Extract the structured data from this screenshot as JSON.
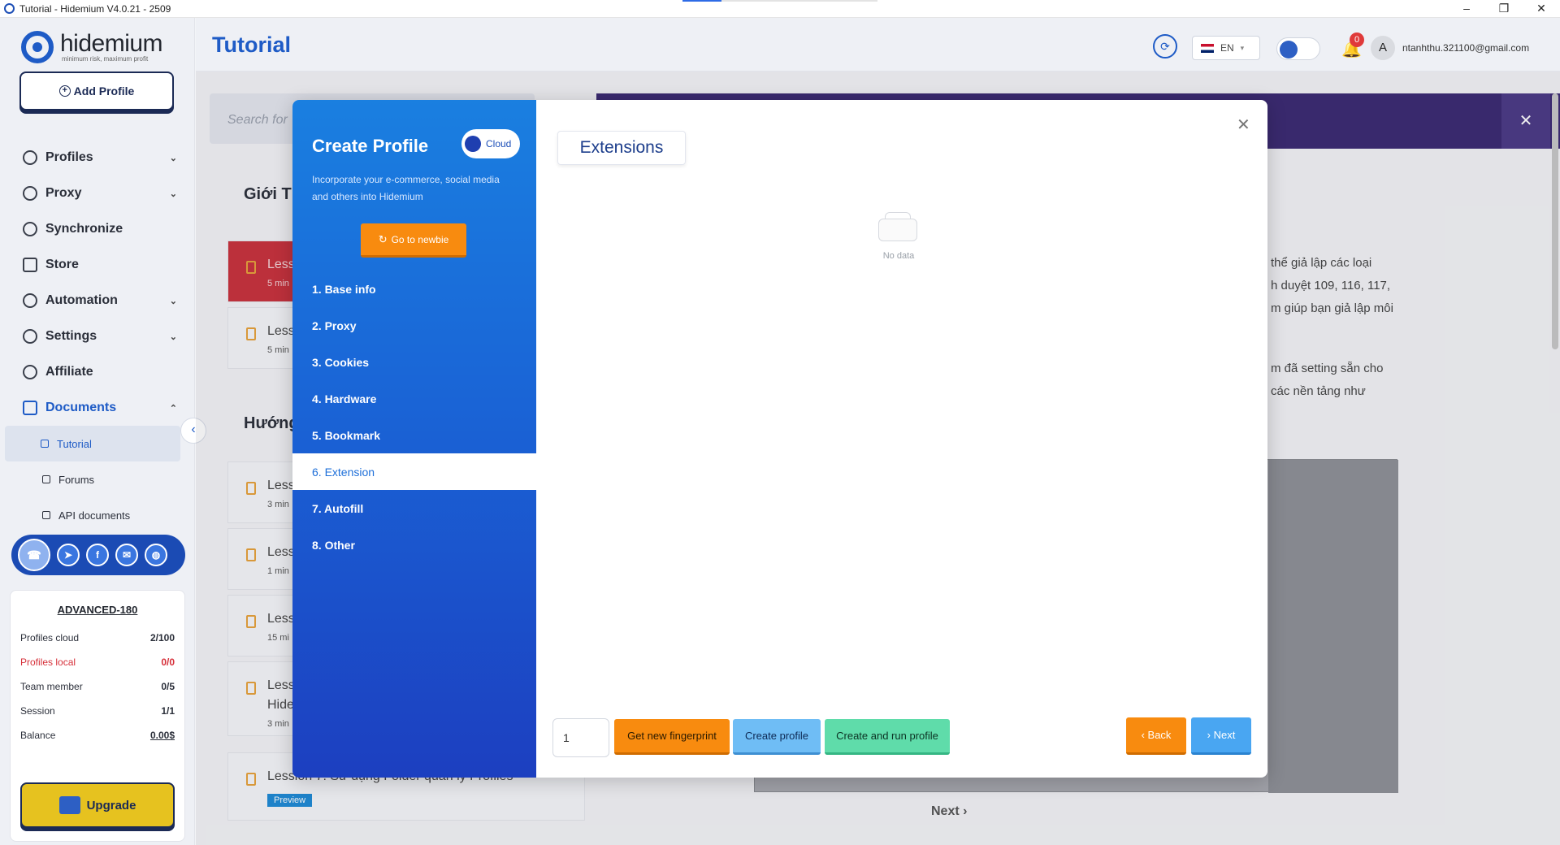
{
  "window": {
    "title": "Tutorial - Hidemium V4.0.21 - 2509",
    "minimize": "–",
    "maximize": "❐",
    "close": "✕"
  },
  "sidebar": {
    "logo_name": "hidemium",
    "logo_tagline": "minimum risk, maximum profit",
    "add_profile": "Add Profile",
    "items": [
      {
        "label": "Profiles",
        "icon": "profiles-icon",
        "chevron": "⌄"
      },
      {
        "label": "Proxy",
        "icon": "globe-icon",
        "chevron": "⌄"
      },
      {
        "label": "Synchronize",
        "icon": "sync-gear-icon"
      },
      {
        "label": "Store",
        "icon": "store-icon"
      },
      {
        "label": "Automation",
        "icon": "automation-icon",
        "chevron": "⌄"
      },
      {
        "label": "Settings",
        "icon": "gear-icon",
        "chevron": "⌄"
      },
      {
        "label": "Affiliate",
        "icon": "affiliate-icon"
      },
      {
        "label": "Documents",
        "icon": "documents-icon",
        "chevron": "⌃"
      }
    ],
    "sub_items": [
      {
        "label": "Tutorial"
      },
      {
        "label": "Forums"
      },
      {
        "label": "API documents"
      }
    ],
    "plan": {
      "title": "ADVANCED-180",
      "rows": [
        {
          "label": "Profiles cloud",
          "value": "2/100"
        },
        {
          "label": "Profiles local",
          "value": "0/0"
        },
        {
          "label": "Team member",
          "value": "0/5"
        },
        {
          "label": "Session",
          "value": "1/1"
        },
        {
          "label": "Balance",
          "value": "0.00$"
        }
      ],
      "upgrade": "Upgrade"
    }
  },
  "header": {
    "title": "Tutorial",
    "lang": "EN",
    "notification_count": "0",
    "avatar_letter": "A",
    "email": "ntanhthu.321100@gmail.com"
  },
  "background": {
    "search_placeholder": "Search for",
    "section1": "Giới T",
    "section2": "Hướng",
    "lessons": [
      {
        "title": "Less",
        "meta": "5 min"
      },
      {
        "title": "Less",
        "meta": "5 min"
      },
      {
        "title": "Less",
        "meta": "3 min"
      },
      {
        "title": "Less",
        "meta": "1 min"
      },
      {
        "title": "Less",
        "meta": "15 mi"
      },
      {
        "title": "Less",
        "meta": "3 min",
        "extra": "Hide"
      },
      {
        "title": "Lession 7: Sử dụng Folder quản lý Profiles",
        "badge": "Preview"
      }
    ],
    "text_lines": [
      "thể giả lập các loại",
      "h duyệt 109, 116, 117,",
      "m giúp bạn giả lập môi"
    ],
    "text_lines2": [
      "m đã setting sẵn cho",
      "các nền tảng như"
    ],
    "next": "Next ›"
  },
  "modal": {
    "title": "Create Profile",
    "cloud_label": "Cloud",
    "description": "Incorporate your e-commerce, social media and others into Hidemium",
    "newbie_button": "Go to newbie",
    "steps": [
      {
        "label": "1. Base info"
      },
      {
        "label": "2. Proxy"
      },
      {
        "label": "3. Cookies"
      },
      {
        "label": "4. Hardware"
      },
      {
        "label": "5. Bookmark"
      },
      {
        "label": "6. Extension"
      },
      {
        "label": "7. Autofill"
      },
      {
        "label": "8. Other"
      }
    ],
    "active_step": 6,
    "section_tab": "Extensions",
    "empty_text": "No data",
    "quantity": "1",
    "buttons": {
      "fingerprint": "Get new fingerprint",
      "create": "Create profile",
      "create_run": "Create and run profile",
      "back": "‹ Back",
      "next": "› Next"
    }
  },
  "colors": {
    "primary": "#1e5bc6",
    "orange": "#f88b0f",
    "sky": "#6fbdf5",
    "mint": "#5fdcaa",
    "danger": "#d6303a"
  }
}
